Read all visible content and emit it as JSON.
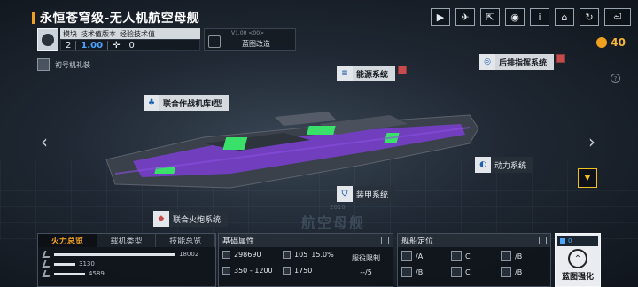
{
  "header": {
    "title": "永恒苍穹级-无人机航空母舰",
    "icons": [
      "video-icon",
      "share-ship-icon",
      "export-icon",
      "view-icon",
      "info-icon",
      "appearance-icon",
      "refresh-icon",
      "back-icon"
    ]
  },
  "currency": {
    "value": "40",
    "color": "#f0a020"
  },
  "ship_info": {
    "headers": [
      "模块",
      "技术值版本",
      "经验技术值"
    ],
    "module": "2",
    "tech_version": "1.00",
    "exp_tech": "0",
    "version_line": "V1.00 <00>",
    "blueprint": "蓝图改造"
  },
  "ceremony_label": "初号机礼装",
  "systems": {
    "energy": "能源系统",
    "rear_command": "后排指挥系统",
    "hangar": "联合作战机库I型",
    "power": "动力系统",
    "armor": "装甲系统",
    "cannon": "联合火炮系统"
  },
  "watermark": {
    "main": "航空母舰",
    "year": "2010"
  },
  "firepower": {
    "tabs": [
      "火力总览",
      "载机类型",
      "技能总览"
    ],
    "rows": [
      {
        "value": "18002",
        "fraction": 0.98
      },
      {
        "value": "3130",
        "fraction": 0.17
      },
      {
        "value": "4589",
        "fraction": 0.25
      }
    ]
  },
  "basic_attrs": {
    "title": "基础属性",
    "hp": "298690",
    "speed_a": "105",
    "speed_b": "15.0%",
    "range": "350 - 1200",
    "armor": "1750",
    "service_limit_label": "服役限制",
    "service_limit_value": "--/5"
  },
  "positioning": {
    "title": "舰船定位",
    "cells": [
      [
        "/A",
        "C",
        "/B"
      ],
      [
        "/B",
        "C",
        "/B"
      ]
    ]
  },
  "strengthen": {
    "label": "蓝图强化",
    "counter": "0"
  },
  "colors": {
    "accent": "#f0a020",
    "blue_value": "#4da6ff",
    "ship_purple": "#7b3fd1",
    "ship_green": "#39e06a"
  }
}
